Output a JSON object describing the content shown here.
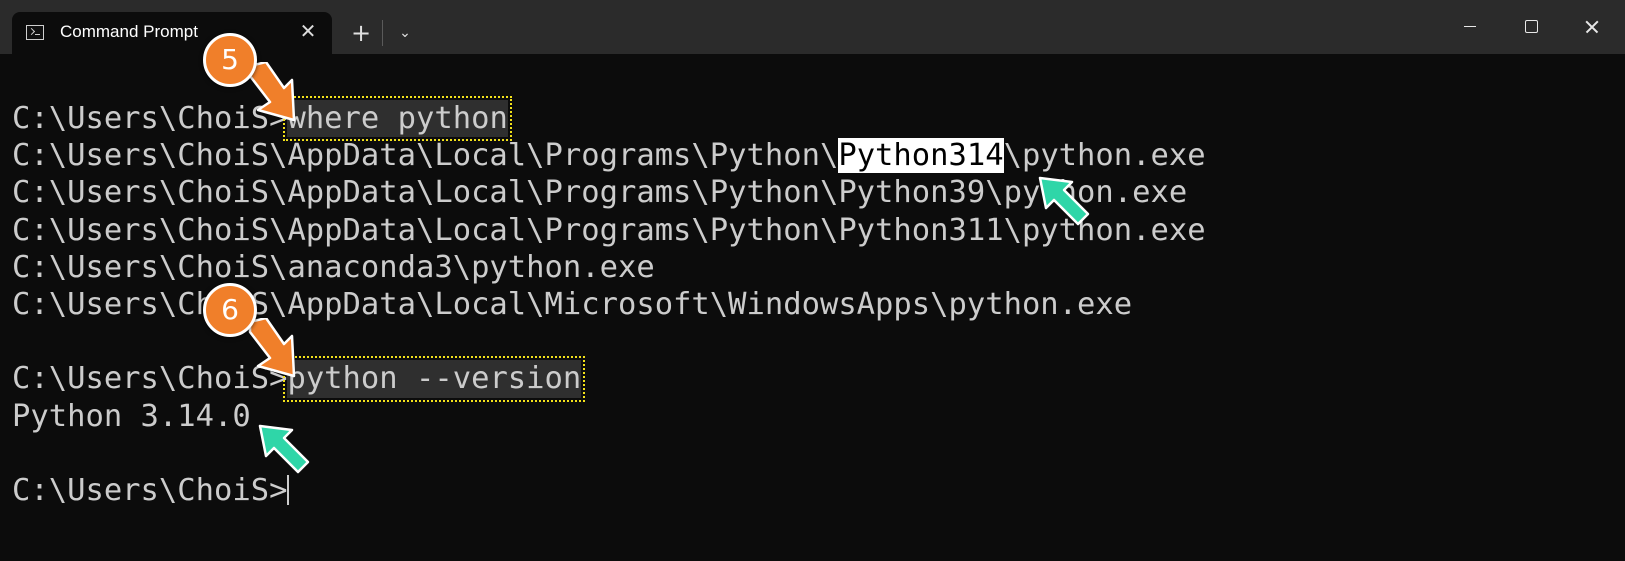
{
  "window": {
    "tab_title": "Command Prompt",
    "tab_close_glyph": "✕",
    "new_tab_glyph": "+",
    "dropdown_glyph": "⌄"
  },
  "terminal": {
    "lines": [
      {
        "prompt": "C:\\Users\\ChoiS>",
        "command": "where python"
      },
      {
        "pre": "C:\\Users\\ChoiS\\AppData\\Local\\Programs\\Python\\",
        "highlight": "Python314",
        "post": "\\python.exe"
      },
      {
        "text": "C:\\Users\\ChoiS\\AppData\\Local\\Programs\\Python\\Python39\\python.exe"
      },
      {
        "text": "C:\\Users\\ChoiS\\AppData\\Local\\Programs\\Python\\Python311\\python.exe"
      },
      {
        "text": "C:\\Users\\ChoiS\\anaconda3\\python.exe"
      },
      {
        "text": "C:\\Users\\ChoiS\\AppData\\Local\\Microsoft\\WindowsApps\\python.exe"
      },
      {
        "prompt": "C:\\Users\\ChoiS>",
        "command": "python --version"
      },
      {
        "text": "Python 3.14.0"
      },
      {
        "prompt": "C:\\Users\\ChoiS>"
      }
    ]
  },
  "annotations": {
    "step_a": "5",
    "step_b": "6",
    "badge_color": "#f07f2a",
    "pointer_color": "#2fd6a8",
    "box_color": "#f2e11a"
  },
  "colors": {
    "background": "#0c0c0c",
    "titlebar": "#2b2b2b",
    "text": "#cccccc"
  }
}
